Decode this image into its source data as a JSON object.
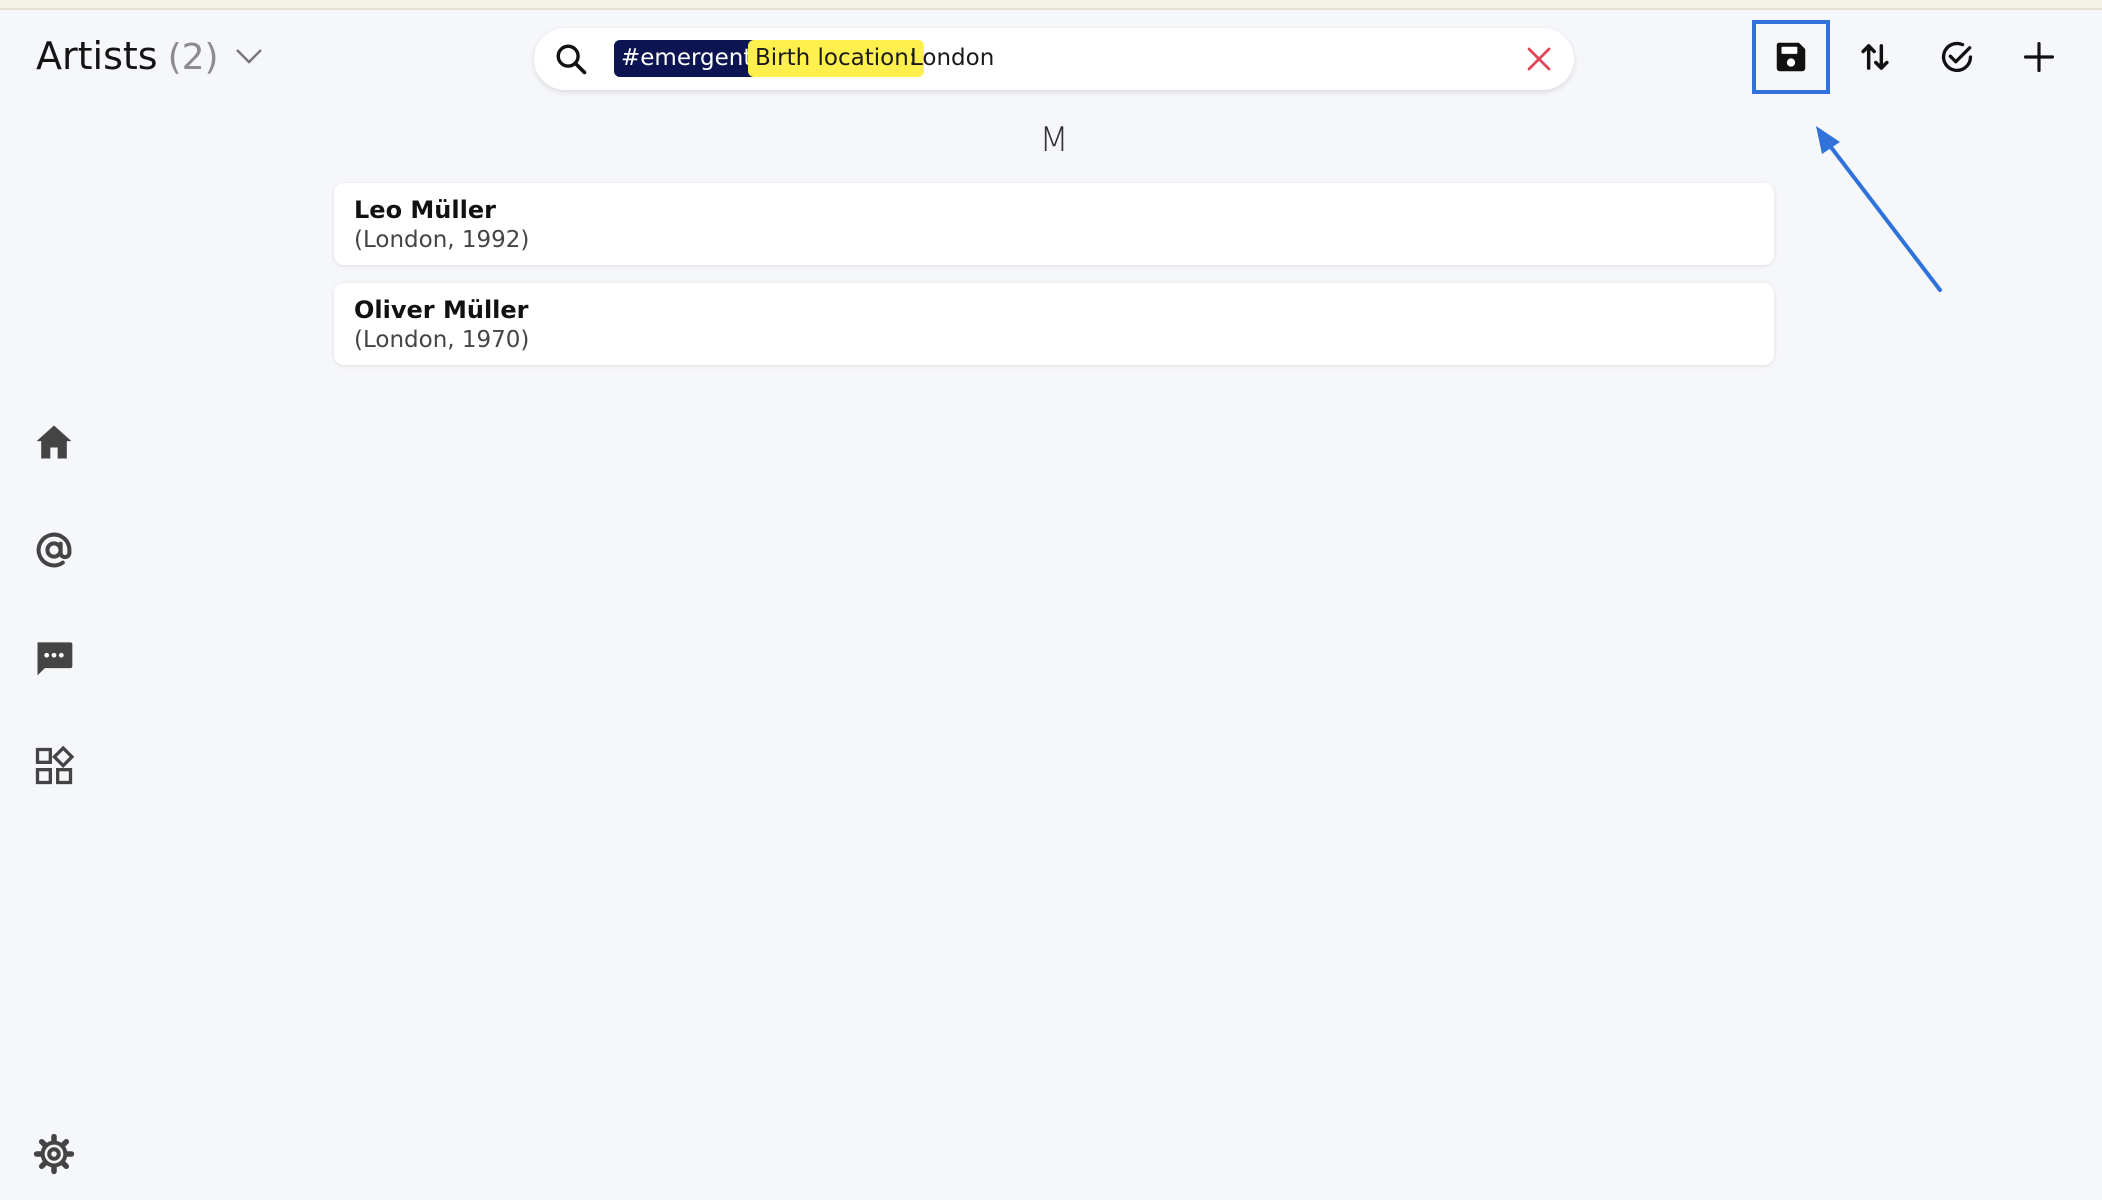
{
  "header": {
    "title": "Artists",
    "count": "(2)"
  },
  "search": {
    "tag_chip": "#emergent",
    "field_chip": "Birth location:",
    "value": "London"
  },
  "list": {
    "section_letter": "M",
    "items": [
      {
        "name": "Leo Müller",
        "detail": "(London, 1992)"
      },
      {
        "name": "Oliver Müller",
        "detail": "(London, 1970)"
      }
    ]
  },
  "colors": {
    "tag_chip_bg": "#0d1452",
    "field_chip_bg": "#fff04e",
    "highlight_border": "#2f73da",
    "clear_icon": "#e0455a",
    "background": "#f6f7fa"
  },
  "icons": {
    "toolbar": [
      "save-icon",
      "sort-icon",
      "check-circle-icon",
      "plus-icon"
    ],
    "sidebar": [
      "home-icon",
      "at-icon",
      "chat-icon",
      "apps-icon",
      "gear-icon"
    ],
    "search": [
      "search-icon",
      "clear-icon"
    ],
    "header": [
      "chevron-down-icon"
    ]
  }
}
